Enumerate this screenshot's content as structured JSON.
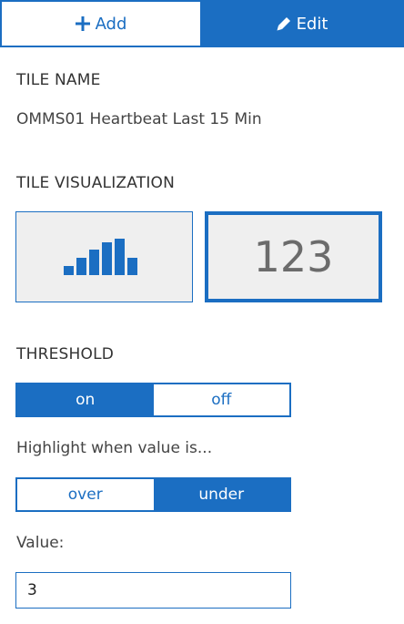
{
  "tabs": {
    "add_label": "Add",
    "edit_label": "Edit",
    "active": "add"
  },
  "tile_name": {
    "heading": "TILE NAME",
    "value": "OMMS01 Heartbeat Last 15 Min"
  },
  "tile_visualization": {
    "heading": "TILE VISUALIZATION",
    "options": [
      {
        "name": "bar-chart",
        "icon": "bar-chart-icon",
        "selected": false
      },
      {
        "name": "number",
        "label": "123",
        "selected": true
      }
    ]
  },
  "threshold": {
    "heading": "THRESHOLD",
    "on_label": "on",
    "off_label": "off",
    "state": "on"
  },
  "highlight": {
    "hint": "Highlight when value is...",
    "over_label": "over",
    "under_label": "under",
    "state": "under"
  },
  "value_field": {
    "label": "Value:",
    "value": "3"
  },
  "colors": {
    "accent": "#1b6ec2",
    "tile_bg": "#efefef"
  }
}
